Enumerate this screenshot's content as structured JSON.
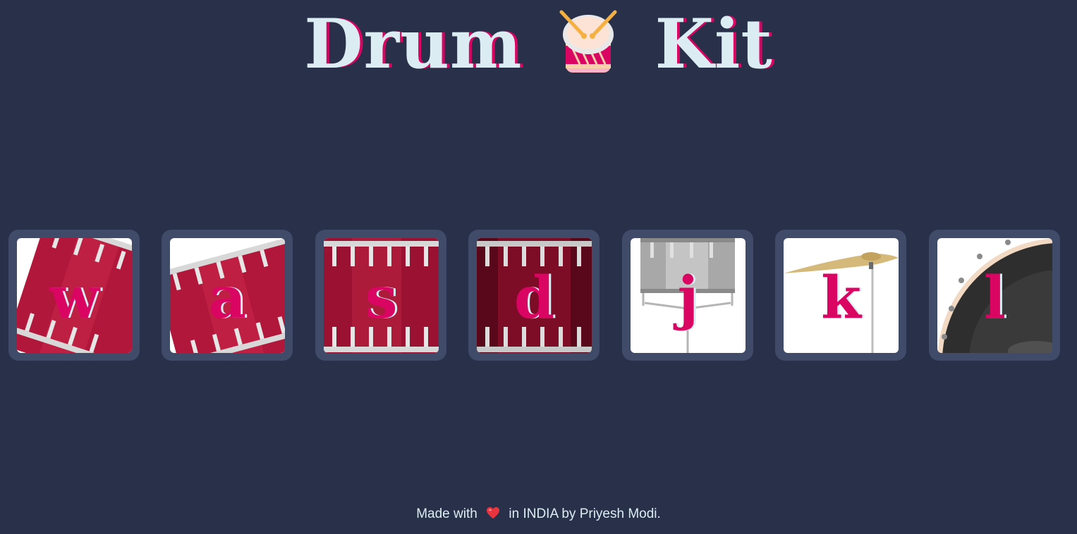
{
  "header": {
    "title_left": "Drum",
    "title_right": "Kit",
    "title_icon": "drum-icon"
  },
  "colors": {
    "background": "#283149",
    "pad_frame": "#404b69",
    "accent": "#da0463",
    "text_light": "#dbedf3"
  },
  "drums": [
    {
      "key": "w",
      "image": "tom-drum-tilted-image"
    },
    {
      "key": "a",
      "image": "tom-drum-tilted-image"
    },
    {
      "key": "s",
      "image": "tom-drum-image"
    },
    {
      "key": "d",
      "image": "tom-drum-dark-image"
    },
    {
      "key": "j",
      "image": "snare-drum-image"
    },
    {
      "key": "k",
      "image": "crash-cymbal-image"
    },
    {
      "key": "l",
      "image": "kick-drum-image"
    }
  ],
  "footer": {
    "prefix": "Made with",
    "heart_icon": "heart-icon",
    "suffix": "in INDIA by Priyesh Modi."
  }
}
